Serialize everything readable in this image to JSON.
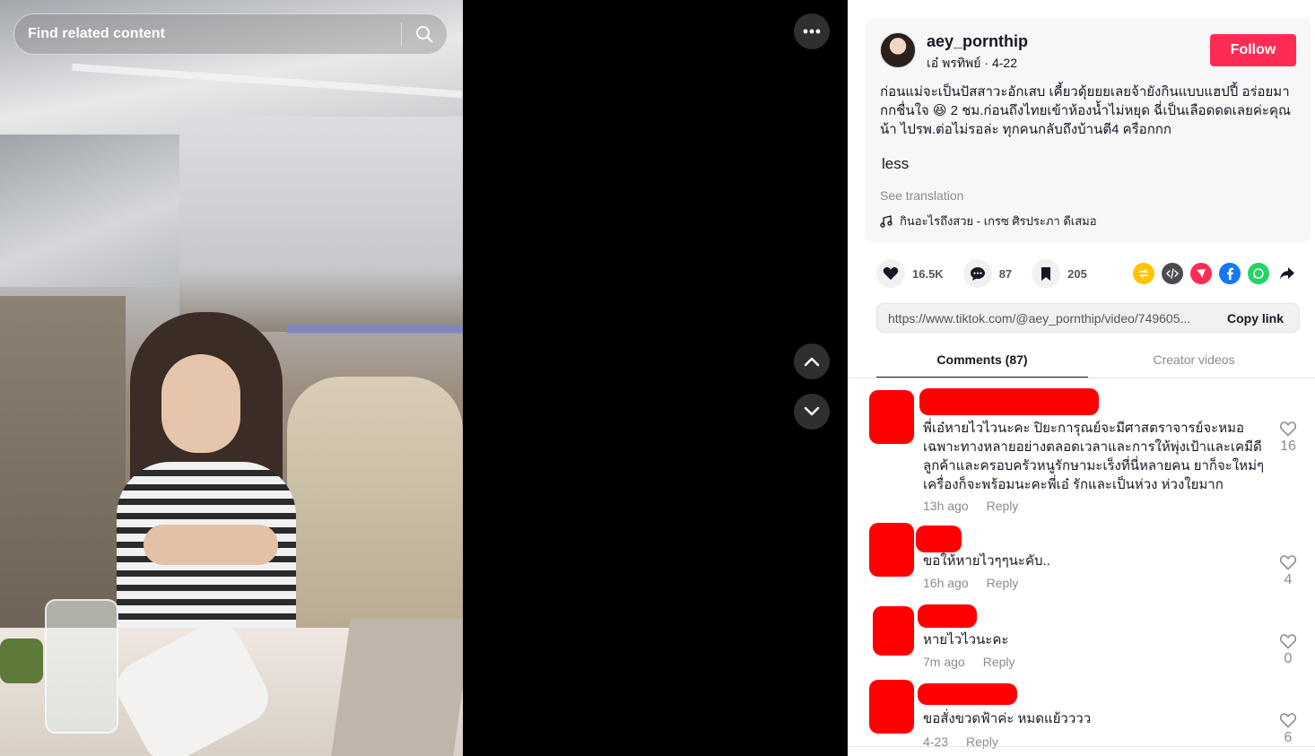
{
  "search": {
    "placeholder": "Find related content"
  },
  "video": {
    "more_label": "•••"
  },
  "author": {
    "username": "aey_pornthip",
    "nickname": "เอ๋ พรทิพย์",
    "date": "4-22",
    "follow_label": "Follow"
  },
  "post": {
    "caption": "ก่อนแม่จะเป็นปัสสาวะอักเสบ เคี้ยวดุ้ยยยเลยจ้ายังกินแบบแฮปปี้ อร่อยมากกชื่นใจ 😆 2 ชม.ก่อนถึงไทยเข้าห้องน้ำไม่หยุด ฉี่เป็นเลือดดดเลยค่ะคุณน้า ไปรพ.ต่อไม่รอล่ะ ทุกคนกลับถึงบ้านตี4 ครือกกก",
    "less_label": "less",
    "see_translation": "See translation",
    "music": "กินอะไรถึงสวย - เกรซ ศิรประภา ดีเสมอ"
  },
  "stats": {
    "likes": "16.5K",
    "comments": "87",
    "saves": "205"
  },
  "link": {
    "url": "https://www.tiktok.com/@aey_pornthip/video/749605...",
    "copy_label": "Copy link"
  },
  "tabs": {
    "comments": "Comments (87)",
    "creator_videos": "Creator videos"
  },
  "comments": [
    {
      "text": "พี่เอ๋หายไวไวนะคะ ปิยะการุณย์จะมีศาสตราจารย์จะหมอเฉพาะทางหลายอย่างตลอดเวลาและการให้พุ่งเป้าและเคมีดี ลูกค้าและครอบครัวหนูรักษามะเร็งที่นี่หลายคน ยาก็จะใหม่ๆ เครื่องก็จะพร้อมนะคะพี่เอ๋ รักและเป็นห่วง ห่วงใยมาก",
      "time": "13h ago",
      "reply": "Reply",
      "likes": "16"
    },
    {
      "text": "ขอให้หายไวๆๆนะคับ..",
      "time": "16h ago",
      "reply": "Reply",
      "likes": "4"
    },
    {
      "text": "หายไวไวนะคะ",
      "time": "7m ago",
      "reply": "Reply",
      "likes": "0"
    },
    {
      "text": "ขอสั่งขวดฟ้าค่ะ หมดแย้วววว",
      "time": "4-23",
      "reply": "Reply",
      "likes": "6"
    }
  ],
  "colors": {
    "brand": "#fe2c55",
    "text": "#161823",
    "muted": "#8a8b91",
    "redaction": "#ff0000"
  }
}
